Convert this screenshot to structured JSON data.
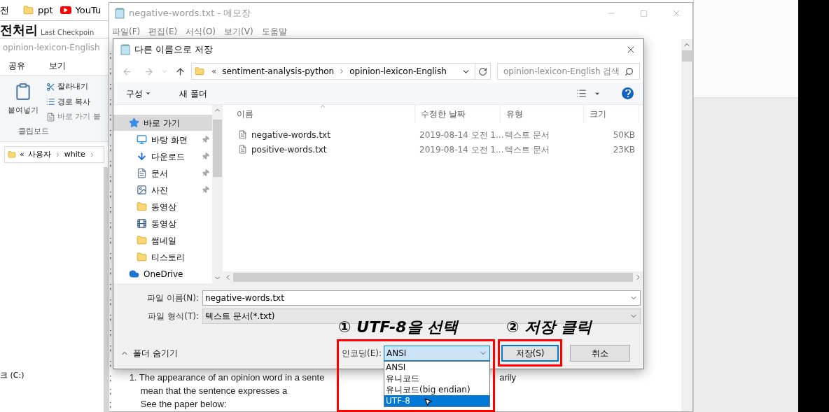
{
  "browser_bar": {
    "tab_fragment": "전",
    "bookmarks": [
      {
        "label": "ppt",
        "kind": "folder"
      },
      {
        "label": "YouTu",
        "kind": "video"
      }
    ]
  },
  "page_heading": {
    "title": "전처리",
    "subtitle": "Last Checkpoin"
  },
  "explorer": {
    "title": "opinion-lexicon-English",
    "tabs": [
      "공유",
      "보기"
    ],
    "paste_label": "붙여넣기",
    "commands": [
      {
        "label": "잘라내기",
        "kind": "cut"
      },
      {
        "label": "경로 복사",
        "kind": "path"
      },
      {
        "label": "바로 가기 붙",
        "kind": "shortcut"
      }
    ],
    "group_label": "클립보드",
    "breadcrumb_prefix": "«",
    "breadcrumb": [
      "사용자",
      "white"
    ],
    "drive_fragment": "크 (C:)"
  },
  "notepad": {
    "title": "negative-words.txt - 메모장",
    "menu": [
      "파일(F)",
      "편집(E)",
      "서식(O)",
      "보기(V)",
      "도움말"
    ],
    "lines": [
      {
        "mark": ";"
      },
      {
        "mark": ";"
      },
      {
        "mark": ";"
      },
      {
        "mark": ";"
      },
      {
        "mark": ";"
      },
      {
        "mark": ";"
      },
      {
        "mark": ";"
      },
      {
        "mark": ";"
      },
      {
        "mark": ";"
      },
      {
        "mark": ";"
      },
      {
        "mark": ";"
      },
      {
        "mark": ";"
      },
      {
        "mark": ";"
      },
      {
        "mark": ";"
      },
      {
        "mark": ";"
      },
      {
        "mark": ";"
      },
      {
        "mark": ";"
      },
      {
        "mark": ";"
      },
      {
        "mark": ";"
      },
      {
        "mark": ";"
      },
      {
        "mark": ";"
      },
      {
        "mark": ";",
        "kind": "item",
        "text": "1. The appearance of an opinion word in a sente",
        "tail": "arily"
      },
      {
        "mark": ";",
        "kind": "continuation",
        "text": "mean that the sentence expresses a"
      },
      {
        "mark": ";",
        "kind": "continuation",
        "text": "See the paper below:"
      }
    ]
  },
  "save_dialog": {
    "title": "다른 이름으로 저장",
    "path_prefix": "«",
    "path": [
      "sentiment-analysis-python",
      "opinion-lexicon-English"
    ],
    "search_placeholder": "opinion-lexicon-English 검색",
    "organize": "구성",
    "new_folder": "새 폴더",
    "nav_items": [
      {
        "label": "바로 가기",
        "kind": "star",
        "pinned": false,
        "selected": true
      },
      {
        "label": "바탕 화면",
        "kind": "desktop",
        "pinned": true,
        "selected": false
      },
      {
        "label": "다운로드",
        "kind": "download",
        "pinned": true,
        "selected": false
      },
      {
        "label": "문서",
        "kind": "document",
        "pinned": true,
        "selected": false
      },
      {
        "label": "사진",
        "kind": "picture",
        "pinned": true,
        "selected": false
      },
      {
        "label": "동영상",
        "kind": "folder",
        "pinned": false,
        "selected": false
      },
      {
        "label": "동영상",
        "kind": "video",
        "pinned": false,
        "selected": false
      },
      {
        "label": "썸네일",
        "kind": "folder",
        "pinned": false,
        "selected": false
      },
      {
        "label": "티스토리",
        "kind": "folder",
        "pinned": false,
        "selected": false
      },
      {
        "label": "OneDrive",
        "kind": "cloud",
        "pinned": false,
        "selected": false
      }
    ],
    "columns": [
      "이름",
      "수정한 날짜",
      "유형",
      "크기"
    ],
    "files": [
      {
        "name": "negative-words.txt",
        "date": "2019-08-14 오전 1...",
        "type": "텍스트 문서",
        "size": "50KB"
      },
      {
        "name": "positive-words.txt",
        "date": "2019-08-14 오전 1...",
        "type": "텍스트 문서",
        "size": "23KB"
      }
    ],
    "file_name_label": "파일 이름(N):",
    "file_name": "negative-words.txt",
    "file_type_label": "파일 형식(T):",
    "file_type": "텍스트 문서(*.txt)",
    "hide_folders": "폴더 숨기기",
    "encoding_label": "인코딩(E):",
    "encoding": "ANSI",
    "encoding_options": [
      {
        "label": "ANSI",
        "selected": false
      },
      {
        "label": "유니코드",
        "selected": false
      },
      {
        "label": "유니코드(big endian)",
        "selected": false
      },
      {
        "label": "UTF-8",
        "selected": true
      }
    ],
    "buttons": [
      {
        "label": "저장(S)",
        "default": true
      },
      {
        "label": "취소",
        "default": false
      }
    ]
  },
  "annotations": [
    {
      "text": "① UTF-8을 선택"
    },
    {
      "text": "② 저장 클릭"
    }
  ]
}
